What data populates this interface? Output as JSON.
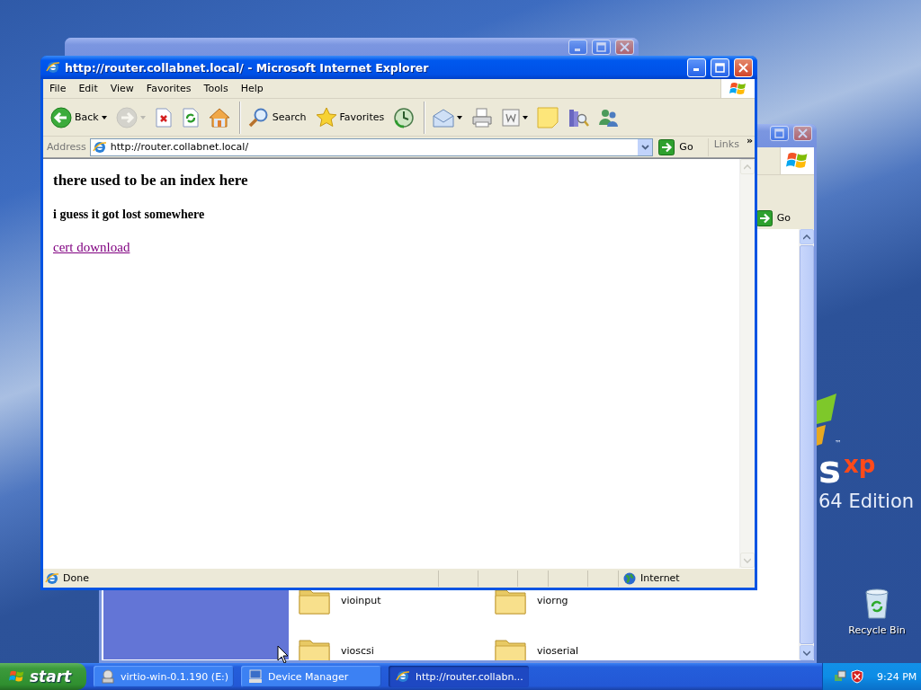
{
  "desktop": {
    "logo": {
      "letter": "s",
      "suffix": "xp",
      "trademark": "™",
      "edition": "64 Edition"
    },
    "icons": [
      {
        "label": "Recycle Bin"
      }
    ]
  },
  "explorer": {
    "go": "Go",
    "folders": [
      {
        "name": "vioinput"
      },
      {
        "name": "viorng"
      },
      {
        "name": "vioscsi"
      },
      {
        "name": "vioserial"
      }
    ]
  },
  "browser": {
    "title": "http://router.collabnet.local/ - Microsoft Internet Explorer",
    "menu": [
      "File",
      "Edit",
      "View",
      "Favorites",
      "Tools",
      "Help"
    ],
    "toolbar": [
      {
        "kind": "back",
        "label": "Back",
        "dropdown": true,
        "disabled": false,
        "separator_before": false
      },
      {
        "kind": "forward",
        "dropdown": true,
        "disabled": true,
        "separator_before": false
      },
      {
        "kind": "stop",
        "disabled": false,
        "separator_before": false
      },
      {
        "kind": "refresh",
        "disabled": false,
        "separator_before": false
      },
      {
        "kind": "home",
        "disabled": false,
        "separator_before": false
      },
      {
        "kind": "search",
        "label": "Search",
        "disabled": false,
        "separator_before": true
      },
      {
        "kind": "favorites",
        "label": "Favorites",
        "disabled": false,
        "separator_before": false
      },
      {
        "kind": "history",
        "disabled": false,
        "separator_before": false
      },
      {
        "kind": "mail",
        "dropdown": true,
        "disabled": false,
        "separator_before": true
      },
      {
        "kind": "print",
        "disabled": false,
        "separator_before": false
      },
      {
        "kind": "edit",
        "dropdown": true,
        "disabled": false,
        "separator_before": false
      },
      {
        "kind": "notes",
        "disabled": false,
        "separator_before": false
      },
      {
        "kind": "research",
        "disabled": false,
        "separator_before": false
      },
      {
        "kind": "messenger",
        "disabled": false,
        "separator_before": false
      }
    ],
    "address": {
      "label": "Address",
      "value": "http://router.collabnet.local/"
    },
    "go": "Go",
    "links": "Links",
    "chevron": "»",
    "page": {
      "heading": "there used to be an index here",
      "subheading": "i guess it got lost somewhere",
      "link": {
        "text": "cert download",
        "visited": true
      }
    },
    "status": {
      "text": "Done",
      "zone": "Internet"
    }
  },
  "taskbar": {
    "start": "start",
    "tasks": [
      {
        "kind": "drive",
        "label": "virtio-win-0.1.190 (E:)",
        "selected": false
      },
      {
        "kind": "computer",
        "label": "Device Manager",
        "selected": false
      },
      {
        "kind": "browser",
        "label": "http://router.collabn...",
        "selected": true
      }
    ],
    "clock": "9:24 PM"
  }
}
